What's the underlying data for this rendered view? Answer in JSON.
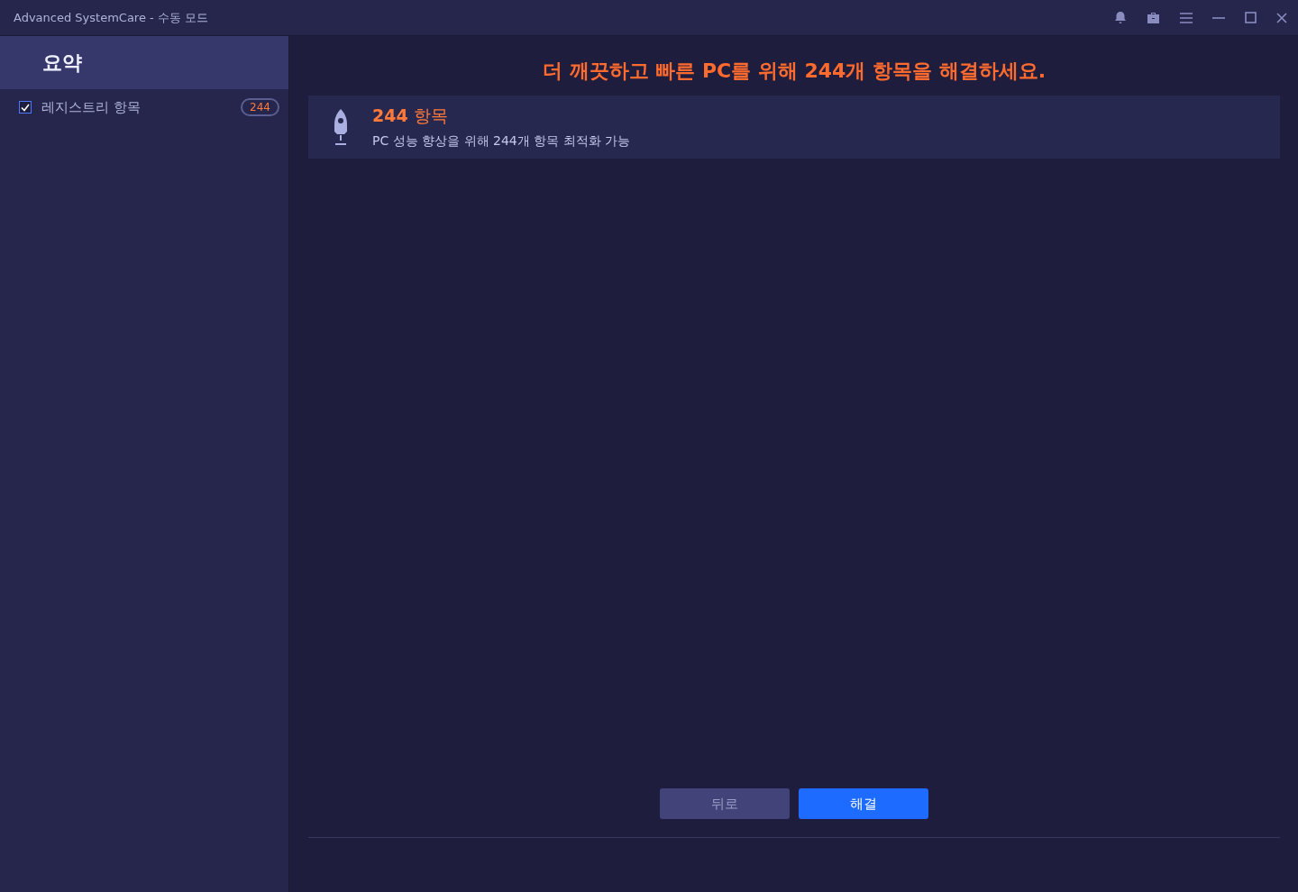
{
  "window": {
    "title": "Advanced SystemCare - 수동 모드"
  },
  "sidebar": {
    "heading": "요약",
    "items": [
      {
        "label": "레지스트리 항목",
        "checked": true,
        "count": "244"
      }
    ]
  },
  "headline": "더 깨끗하고 빠른 PC를 위해 244개 항목을 해결하세요.",
  "result": {
    "title": "**244** 항목",
    "description": "PC 성능 향상을 위해 244개 항목 최적화 가능"
  },
  "buttons": [
    {
      "label": "뒤로",
      "kind": "secondary"
    },
    {
      "label": "해결",
      "kind": "primary"
    }
  ]
}
